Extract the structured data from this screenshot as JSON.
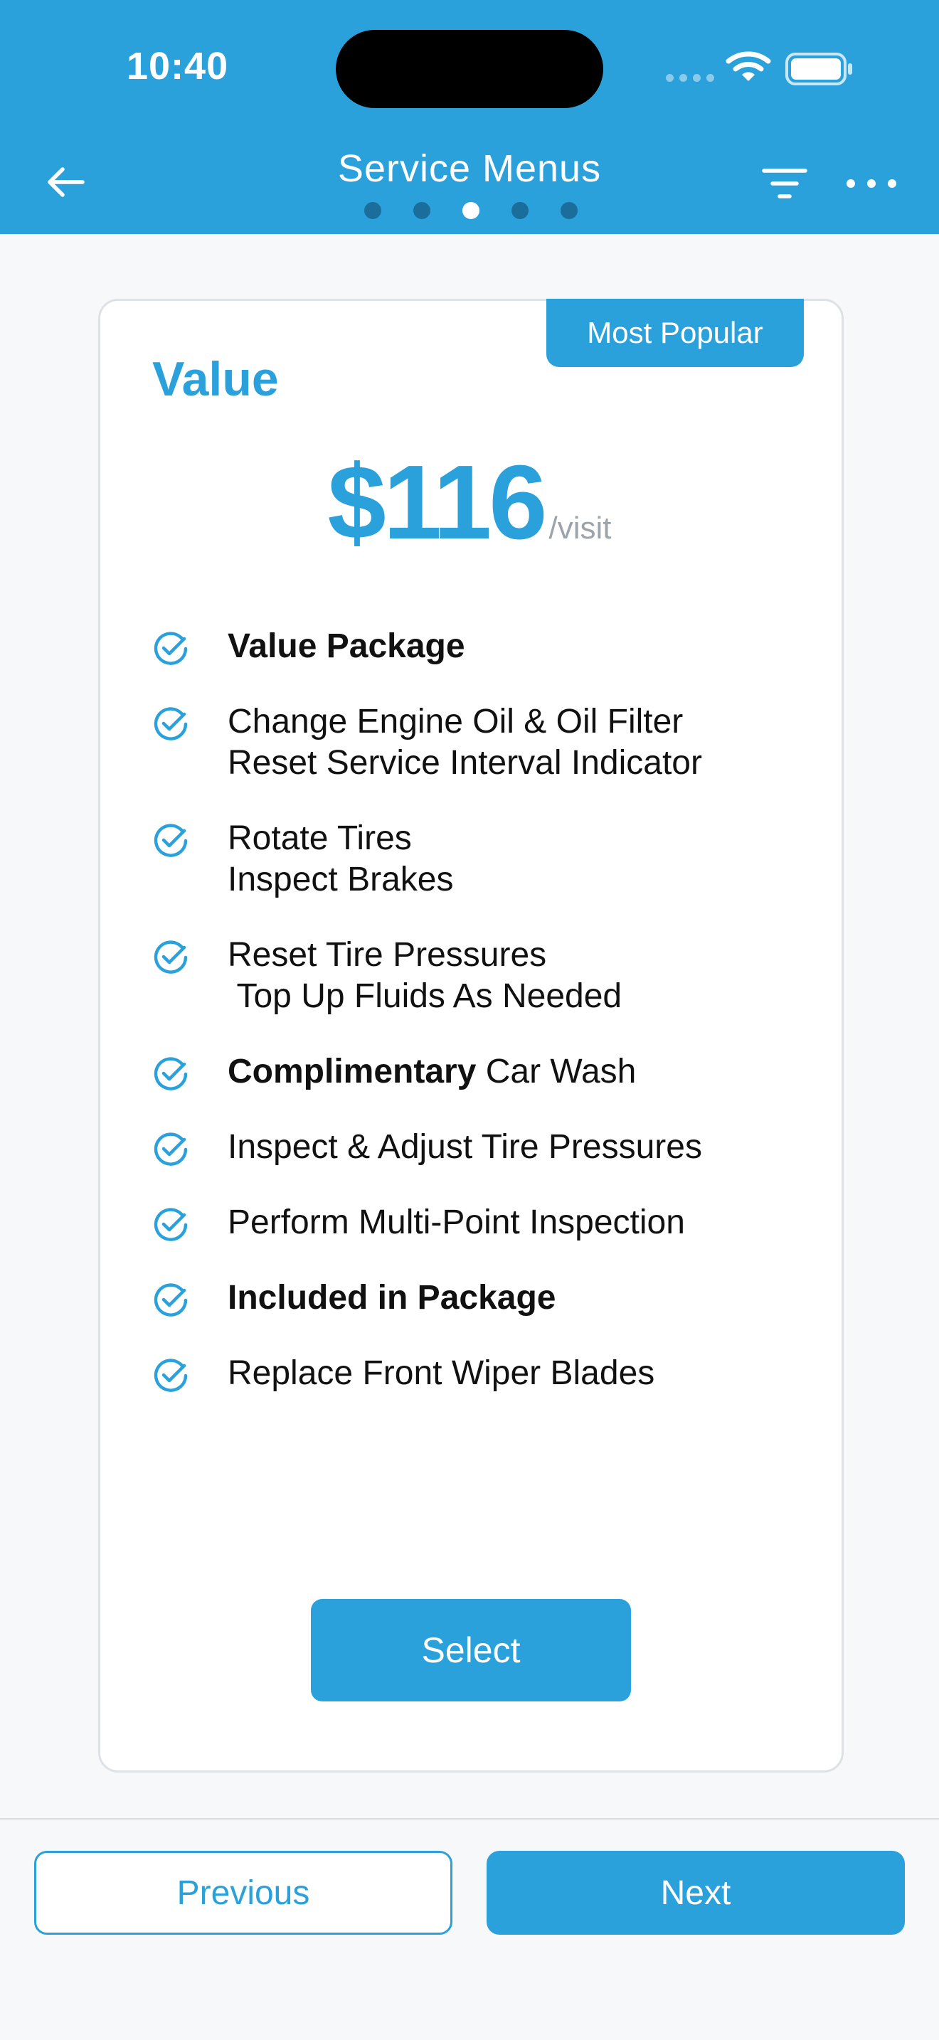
{
  "status_bar": {
    "time": "10:40"
  },
  "header": {
    "title": "Service Menus",
    "page_indicator": {
      "count": 5,
      "active_index": 2
    },
    "icons": {
      "back": "arrow-left-icon",
      "filter": "filter-icon",
      "more": "more-horizontal-icon"
    }
  },
  "card": {
    "badge": "Most Popular",
    "plan_name": "Value",
    "price": "$116",
    "price_unit": "/visit",
    "features": [
      {
        "lines": [
          [
            {
              "text": "Value Package",
              "bold": true
            }
          ]
        ]
      },
      {
        "lines": [
          [
            {
              "text": "Change Engine Oil & Oil Filter",
              "bold": false
            }
          ],
          [
            {
              "text": "Reset Service Interval Indicator",
              "bold": false
            }
          ]
        ]
      },
      {
        "lines": [
          [
            {
              "text": "Rotate Tires",
              "bold": false
            }
          ],
          [
            {
              "text": "Inspect Brakes",
              "bold": false
            }
          ]
        ]
      },
      {
        "lines": [
          [
            {
              "text": "Reset Tire Pressures",
              "bold": false
            }
          ],
          [
            {
              "text": " Top Up Fluids As Needed",
              "bold": false
            }
          ]
        ]
      },
      {
        "lines": [
          [
            {
              "text": "Complimentary",
              "bold": true
            },
            {
              "text": " Car Wash",
              "bold": false
            }
          ]
        ]
      },
      {
        "lines": [
          [
            {
              "text": "Inspect & Adjust Tire Pressures",
              "bold": false
            }
          ]
        ]
      },
      {
        "lines": [
          [
            {
              "text": "Perform Multi-Point Inspection",
              "bold": false
            }
          ]
        ]
      },
      {
        "lines": [
          [
            {
              "text": "Included in Package",
              "bold": true
            }
          ]
        ]
      },
      {
        "lines": [
          [
            {
              "text": "Replace Front Wiper Blades",
              "bold": false
            }
          ]
        ]
      }
    ],
    "select_label": "Select"
  },
  "footer": {
    "previous_label": "Previous",
    "next_label": "Next"
  },
  "colors": {
    "accent": "#2BA1DB",
    "background": "#F6F8FA",
    "muted": "#9CA3AA"
  }
}
